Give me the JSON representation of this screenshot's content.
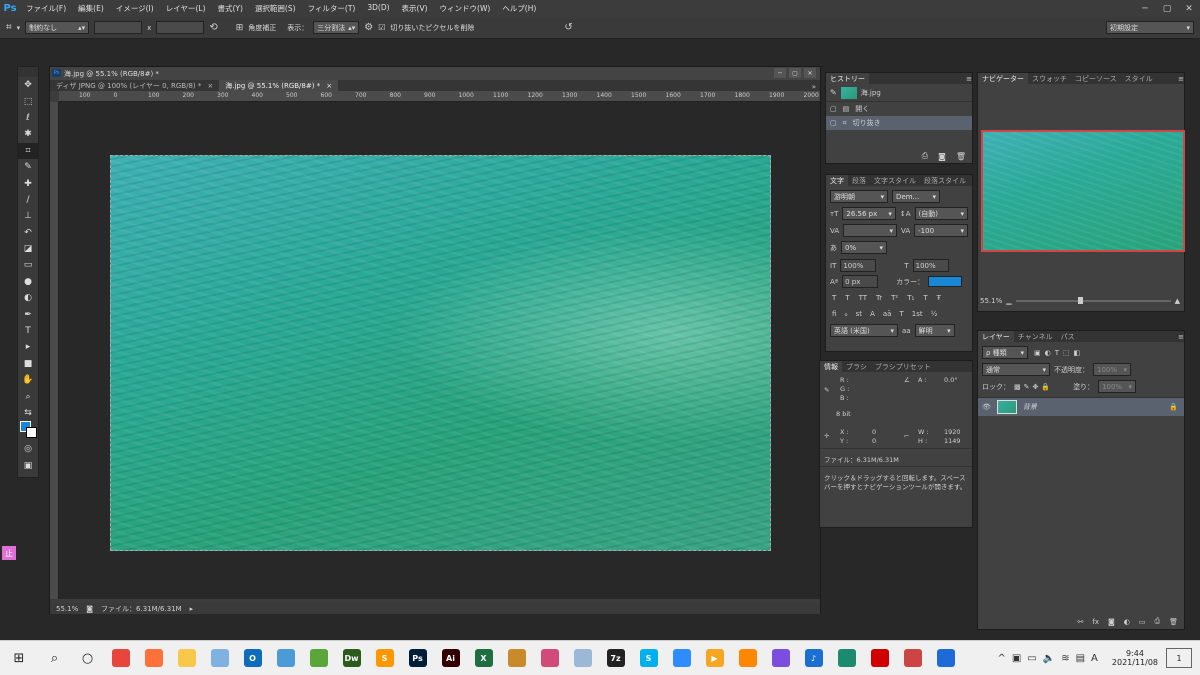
{
  "menu": {
    "logo": "Ps",
    "items": [
      "ファイル(F)",
      "編集(E)",
      "イメージ(I)",
      "レイヤー(L)",
      "書式(Y)",
      "選択範囲(S)",
      "フィルター(T)",
      "3D(D)",
      "表示(V)",
      "ウィンドウ(W)",
      "ヘルプ(H)"
    ]
  },
  "options": {
    "ratio": "制約なし",
    "x": "x",
    "straighten": "角度補正",
    "view_label": "表示：",
    "view_value": "三分割法",
    "delete_cropped": "切り抜いたピクセルを削除",
    "workspace": "初期設定"
  },
  "document": {
    "title": "海.jpg @ 55.1% (RGB/8#) *",
    "tabs": [
      {
        "label": "ディザ JPNG @ 100% (レイヤー 0, RGB/8) *",
        "close": "×",
        "active": false
      },
      {
        "label": "海.jpg @ 55.1% (RGB/8#) *",
        "close": "×",
        "active": true
      }
    ],
    "ruler_labels": [
      "100",
      "0",
      "100",
      "200",
      "300",
      "400",
      "500",
      "600",
      "700",
      "800",
      "900",
      "1000",
      "1100",
      "1200",
      "1300",
      "1400",
      "1500",
      "1600",
      "1700",
      "1800",
      "1900",
      "2000"
    ],
    "zoom": "55.1%",
    "file_info": "ファイル：6.31M/6.31M"
  },
  "history": {
    "tab": "ヒストリー",
    "snapshot": "海.jpg",
    "items": [
      "開く",
      "切り抜き"
    ]
  },
  "character": {
    "tabs": [
      "文字",
      "段落",
      "文字スタイル",
      "段落スタイル"
    ],
    "font_family": "游明朝",
    "font_style": "Dem...",
    "size": "26.56 px",
    "leading": "(自動)",
    "kerning": "",
    "tracking": "-100",
    "tsume": "0%",
    "vscale": "100%",
    "hscale": "100%",
    "baseline": "0 px",
    "color_label": "カラー：",
    "color": "#1a86d6",
    "styles": [
      "T",
      "T",
      "TT",
      "Tr",
      "T²",
      "T₁",
      "T",
      "Ŧ"
    ],
    "ot": [
      "fi",
      "ℴ",
      "st",
      "A",
      "aā",
      "T",
      "1st",
      "½"
    ],
    "language": "英語 (米国)",
    "aa_label": "aa",
    "aa": "鮮明"
  },
  "info": {
    "tabs": [
      "情報",
      "ブラシ",
      "ブラシプリセット"
    ],
    "r": "R :",
    "g": "G :",
    "b": "B :",
    "a_label": "A :",
    "a_value": "0.0°",
    "bit": "8 bit",
    "x_label": "X :",
    "x_value": "0",
    "y_label": "Y :",
    "y_value": "0",
    "w_label": "W :",
    "w_value": "1920",
    "h_label": "H :",
    "h_value": "1149",
    "file": "ファイル：6.31M/6.31M",
    "hint1": "クリック＆ドラッグすると回転します。スペース",
    "hint2": "バーを押すとナビゲーションツールが開きます。"
  },
  "navigator": {
    "tabs": [
      "ナビゲーター",
      "スウォッチ",
      "コピーソース",
      "スタイル"
    ],
    "zoom": "55.1%"
  },
  "layers": {
    "tabs": [
      "レイヤー",
      "チャンネル",
      "パス"
    ],
    "filter": "ρ 種類",
    "blend": "通常",
    "opacity_label": "不透明度：",
    "opacity": "100%",
    "lock_label": "ロック：",
    "fill_label": "塗り：",
    "fill": "100%",
    "layer_name": "背景"
  },
  "taskbar": {
    "time": "9:44",
    "date": "2021/11/08",
    "ime": "A",
    "notif": "1",
    "apps": [
      {
        "name": "chrome",
        "text": "",
        "color": "#e8453c"
      },
      {
        "name": "firefox",
        "text": "",
        "color": "#ff7139"
      },
      {
        "name": "explorer",
        "text": "",
        "color": "#f8c84a"
      },
      {
        "name": "app4",
        "text": "",
        "color": "#7fb2e0"
      },
      {
        "name": "outlook",
        "text": "O",
        "color": "#0f6cbd"
      },
      {
        "name": "app6",
        "text": "",
        "color": "#4d9bd6"
      },
      {
        "name": "app7",
        "text": "",
        "color": "#5aa63a"
      },
      {
        "name": "dreamweaver",
        "text": "Dw",
        "color": "#2d5b1e"
      },
      {
        "name": "sublime",
        "text": "S",
        "color": "#ff9800"
      },
      {
        "name": "photoshop",
        "text": "Ps",
        "color": "#001e36"
      },
      {
        "name": "illustrator",
        "text": "Ai",
        "color": "#330000"
      },
      {
        "name": "excel",
        "text": "X",
        "color": "#1d6f42"
      },
      {
        "name": "app13",
        "text": "",
        "color": "#c88a2a"
      },
      {
        "name": "app14",
        "text": "",
        "color": "#d24a7a"
      },
      {
        "name": "app15",
        "text": "",
        "color": "#9bb8d8"
      },
      {
        "name": "7zip",
        "text": "7z",
        "color": "#222"
      },
      {
        "name": "skype",
        "text": "S",
        "color": "#00aff0"
      },
      {
        "name": "zoom",
        "text": "",
        "color": "#2d8cff"
      },
      {
        "name": "player",
        "text": "▶",
        "color": "#f5a623"
      },
      {
        "name": "vlc",
        "text": "",
        "color": "#ff8800"
      },
      {
        "name": "app21",
        "text": "",
        "color": "#7b4ee0"
      },
      {
        "name": "music",
        "text": "♪",
        "color": "#1a6fd1"
      },
      {
        "name": "app23",
        "text": "",
        "color": "#1c8a6e"
      },
      {
        "name": "record",
        "text": "",
        "color": "#d00000"
      },
      {
        "name": "app25",
        "text": "",
        "color": "#c44"
      },
      {
        "name": "app26",
        "text": "",
        "color": "#1e6ad6"
      }
    ]
  }
}
